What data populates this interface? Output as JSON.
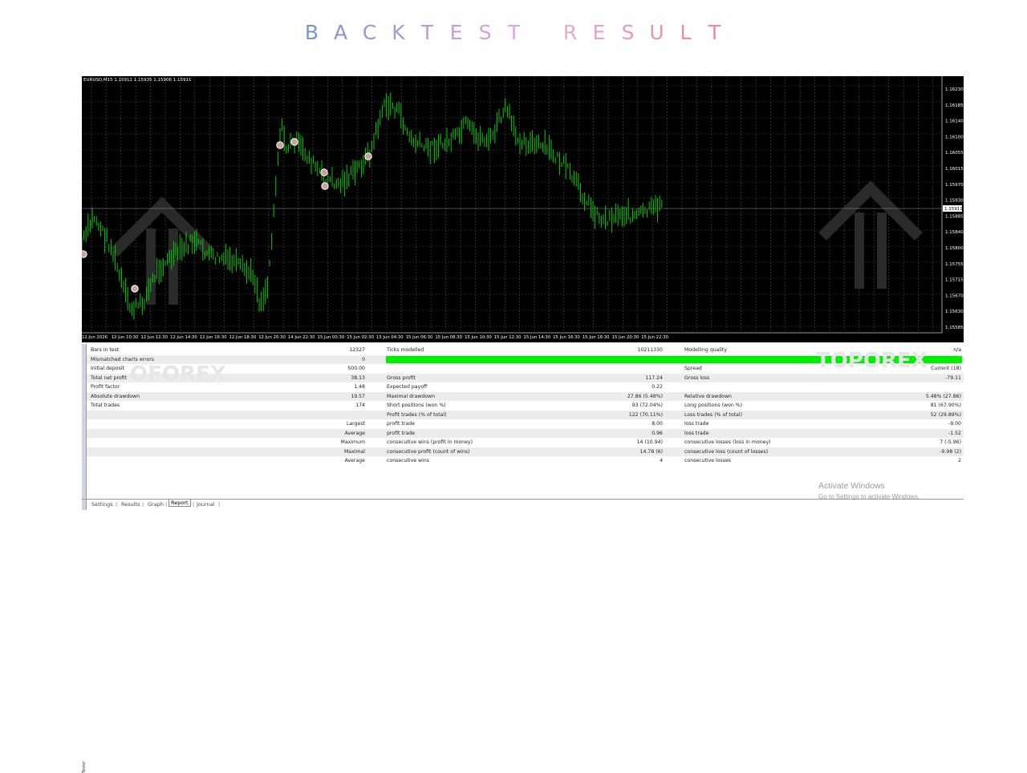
{
  "page": {
    "title_letters": [
      "B",
      "A",
      "C",
      "K",
      "T",
      "E",
      "S",
      "T",
      "",
      "R",
      "E",
      "S",
      "U",
      "L",
      "T"
    ],
    "title_colors": [
      "#7b93cf",
      "#8a94d2",
      "#9a96d4",
      "#aa98d6",
      "#ba9ad6",
      "#c89cd8",
      "#d6a0da",
      "#e0a6dc",
      "",
      "#e9a8cf",
      "#ec9fc5",
      "#ee97bb",
      "#ef90b1",
      "#f08aa8",
      "#f085a0"
    ]
  },
  "chart": {
    "symbol_line": "EURUSD,M15  1.15911 1.15935 1.15906 1.15911",
    "price_labels": [
      "1.16230",
      "1.16185",
      "1.16140",
      "1.16100",
      "1.16055",
      "1.16015",
      "1.15970",
      "1.15930",
      "1.15885",
      "1.15840",
      "1.15800",
      "1.15755",
      "1.15715",
      "1.15670",
      "1.15630",
      "1.15585"
    ],
    "current_price": "1.15911",
    "time_labels": [
      "12 Jun 2026",
      "12 Jun 10:30",
      "12 Jun 12:30",
      "12 Jun 14:30",
      "12 Jun 16:30",
      "12 Jun 18:30",
      "12 Jun 20:30",
      "14 Jun 22:30",
      "15 Jun 00:30",
      "15 Jun 02:30",
      "15 Jun 04:30",
      "15 Jun 06:30",
      "15 Jun 08:30",
      "15 Jun 10:30",
      "15 Jun 12:30",
      "15 Jun 14:30",
      "15 Jun 16:30",
      "15 Jun 18:30",
      "15 Jun 20:30",
      "15 Jun 22:30"
    ],
    "bar_color": "#00cc00",
    "background": "#000000"
  },
  "report": {
    "rows": [
      {
        "c1": "Bars in test",
        "c2": "12327",
        "c3": "Ticks modelled",
        "c4": "10211330",
        "c5": "Modelling quality",
        "c6": "n/a"
      },
      {
        "c1": "Mismatched charts errors",
        "c2": "0",
        "c3": "",
        "c4": "",
        "c5": "",
        "c6": "",
        "bar": true
      },
      {
        "c1": "Initial deposit",
        "c2": "500.00",
        "c3": "",
        "c4": "",
        "c5": "Spread",
        "c6": "Current (18)"
      },
      {
        "c1": "Total net profit",
        "c2": "38.13",
        "c3": "Gross profit",
        "c4": "117.24",
        "c5": "Gross loss",
        "c6": "-79.11"
      },
      {
        "c1": "Profit factor",
        "c2": "1.48",
        "c3": "Expected payoff",
        "c4": "0.22",
        "c5": "",
        "c6": ""
      },
      {
        "c1": "Absolute drawdown",
        "c2": "19.57",
        "c3": "Maximal drawdown",
        "c4": "27.86 (5.48%)",
        "c5": "Relative drawdown",
        "c6": "5.48% (27.86)"
      },
      {
        "c1": "Total trades",
        "c2": "174",
        "c3": "Short positions (won %)",
        "c4": "93 (72.04%)",
        "c5": "Long positions (won %)",
        "c6": "81 (67.90%)"
      },
      {
        "c1": "",
        "c2": "",
        "c3": "Profit trades (% of total)",
        "c4": "122 (70.11%)",
        "c5": "Loss trades (% of total)",
        "c6": "52 (29.89%)"
      },
      {
        "c1": "",
        "c2": "Largest",
        "c3": "profit trade",
        "c4": "8.00",
        "c5": "loss trade",
        "c6": "-9.00"
      },
      {
        "c1": "",
        "c2": "Average",
        "c3": "profit trade",
        "c4": "0.96",
        "c5": "loss trade",
        "c6": "-1.52"
      },
      {
        "c1": "",
        "c2": "Maximum",
        "c3": "consecutive wins (profit in money)",
        "c4": "14 (10.94)",
        "c5": "consecutive losses (loss in money)",
        "c6": "7 (-5.96)"
      },
      {
        "c1": "",
        "c2": "Maximal",
        "c3": "consecutive profit (count of wins)",
        "c4": "14.78 (6)",
        "c5": "consecutive loss (count of losses)",
        "c6": "-9.98 (2)"
      },
      {
        "c1": "",
        "c2": "Average",
        "c3": "consecutive wins",
        "c4": "4",
        "c5": "consecutive losses",
        "c6": "2"
      }
    ],
    "modelling_bar_color": "#00ee00"
  },
  "tabs": {
    "items": [
      "Settings",
      "Results",
      "Graph",
      "Report",
      "Journal"
    ],
    "active": "Report",
    "side_label": "Tester"
  },
  "overlay": {
    "activate_title": "Activate Windows",
    "activate_sub": "Go to Settings to activate Windows.",
    "watermark_left": "OFOREX",
    "watermark_right": "TOPOREX"
  }
}
